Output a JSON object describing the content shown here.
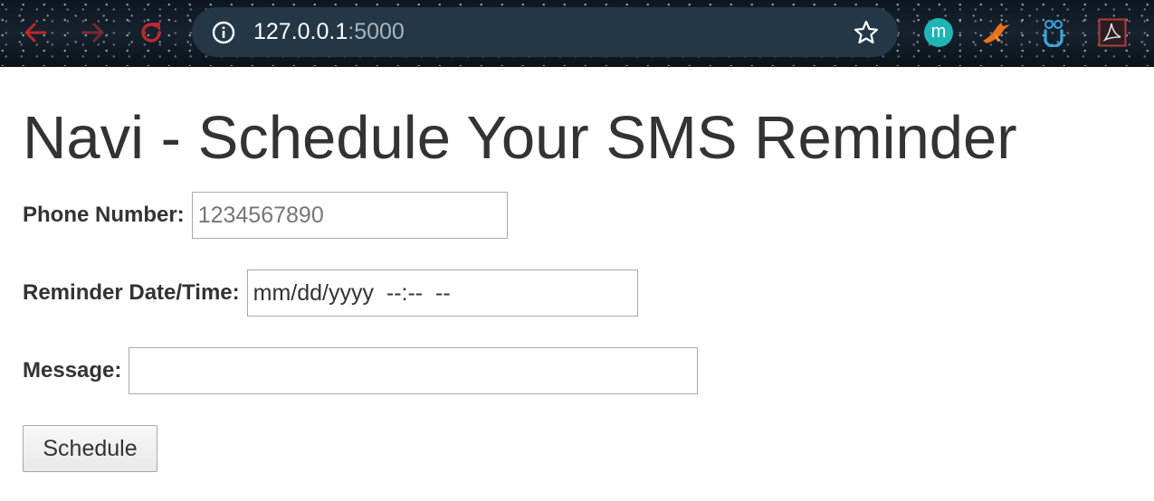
{
  "browser": {
    "url_host": "127.0.0.1",
    "url_port": ":5000",
    "icons": {
      "back": "back-arrow-icon",
      "forward": "forward-arrow-icon",
      "reload": "reload-icon",
      "info": "info-icon",
      "bookmark": "star-icon"
    },
    "extensions": [
      {
        "name": "m",
        "icon": "mendeley-icon",
        "color": "#1fb5b5"
      },
      {
        "name": "bird",
        "icon": "bird-extension-icon",
        "color": "#e8721c"
      },
      {
        "name": "owl",
        "icon": "owl-extension-icon",
        "color": "#3aa7e0"
      },
      {
        "name": "pdf",
        "icon": "pdf-extension-icon",
        "color": "#b83a3a"
      }
    ]
  },
  "page": {
    "title": "Navi - Schedule Your SMS Reminder",
    "form": {
      "phone_label": "Phone Number:",
      "phone_placeholder": "1234567890",
      "datetime_label": "Reminder Date/Time:",
      "datetime_display": "mm/dd/yyyy  --:--  --",
      "message_label": "Message:",
      "message_value": "",
      "submit_label": "Schedule"
    }
  },
  "colors": {
    "nav_arrow": "#c0272d",
    "text": "#333333",
    "omnibox": "#243746"
  }
}
